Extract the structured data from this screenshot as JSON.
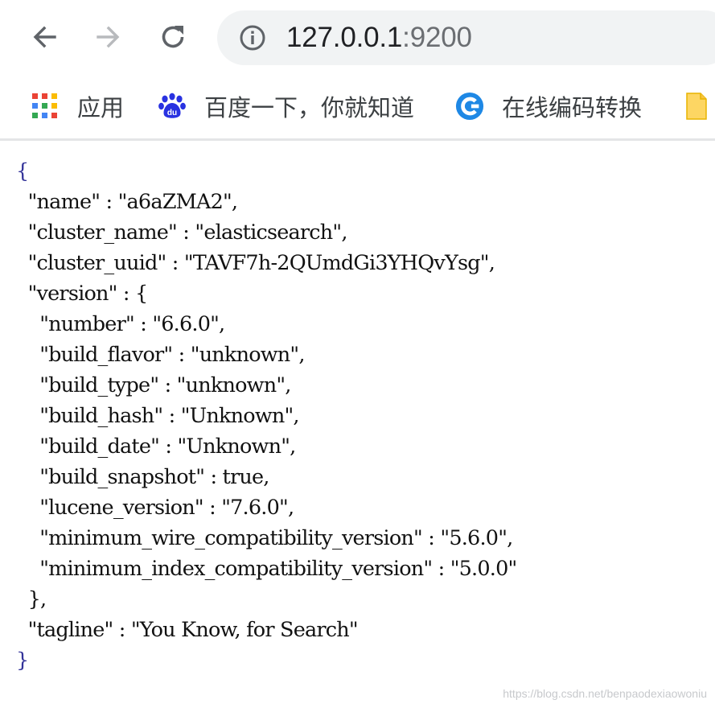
{
  "browser": {
    "url_host": "127.0.0.1",
    "url_port": ":9200",
    "back_icon": "back-arrow-icon",
    "forward_icon": "forward-arrow-icon",
    "reload_icon": "reload-icon",
    "info_icon": "info-icon"
  },
  "bookmarks": [
    {
      "label": "应用",
      "icon": "apps-grid-icon"
    },
    {
      "label": "百度一下，你就知道",
      "icon": "baidu-paw-icon"
    },
    {
      "label": "在线编码转换",
      "icon": "convert-c-icon"
    },
    {
      "label": "",
      "icon": "folder-icon"
    }
  ],
  "json": {
    "open_brace": "{",
    "name": "  \"name\" : \"a6aZMA2\",",
    "cluster_name": "  \"cluster_name\" : \"elasticsearch\",",
    "cluster_uuid": "  \"cluster_uuid\" : \"TAVF7h-2QUmdGi3YHQvYsg\",",
    "version_open": "  \"version\" : {",
    "number": "    \"number\" : \"6.6.0\",",
    "build_flavor": "    \"build_flavor\" : \"unknown\",",
    "build_type": "    \"build_type\" : \"unknown\",",
    "build_hash": "    \"build_hash\" : \"Unknown\",",
    "build_date": "    \"build_date\" : \"Unknown\",",
    "build_snapshot": "    \"build_snapshot\" : true,",
    "lucene_version": "    \"lucene_version\" : \"7.6.0\",",
    "minimum_wire_compatibility_version": "    \"minimum_wire_compatibility_version\" : \"5.6.0\",",
    "minimum_index_compatibility_version": "    \"minimum_index_compatibility_version\" : \"5.0.0\"",
    "version_close": "  },",
    "tagline": "  \"tagline\" : \"You Know, for Search\"",
    "close_brace": "}"
  },
  "watermark": "https://blog.csdn.net/benpaodexiaowoniu",
  "colors": {
    "accent_blue": "#1a73e8",
    "baidu_blue": "#2932e1",
    "toolbar_gray": "#f1f3f4"
  }
}
